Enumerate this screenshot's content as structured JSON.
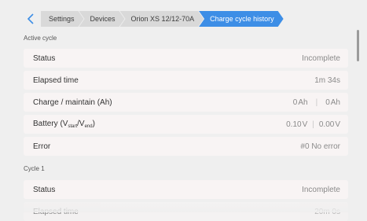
{
  "breadcrumbs": [
    "Settings",
    "Devices",
    "Orion XS 12/12-70A",
    "Charge cycle history"
  ],
  "active_cycle": {
    "heading": "Active cycle",
    "status": {
      "label": "Status",
      "value": "Incomplete"
    },
    "elapsed": {
      "label": "Elapsed time",
      "value": "1m 34s"
    },
    "charge": {
      "label": "Charge / maintain (Ah)",
      "v1": "0",
      "u1": "Ah",
      "v2": "0",
      "u2": "Ah"
    },
    "battery": {
      "label_pre": "Battery (V",
      "sub1": "start",
      "label_mid": "/V",
      "sub2": "end",
      "label_post": ")",
      "v1": "0.10",
      "u1": "V",
      "v2": "0.00",
      "u2": "V"
    },
    "error": {
      "label": "Error",
      "value": "#0 No error"
    }
  },
  "cycle1": {
    "heading": "Cycle 1",
    "status": {
      "label": "Status",
      "value": "Incomplete"
    },
    "elapsed": {
      "label": "Elapsed time",
      "value": "20m 0s"
    }
  },
  "colors": {
    "accent": "#3d8ee6"
  },
  "icons": {
    "back": "chevron-left-icon"
  }
}
